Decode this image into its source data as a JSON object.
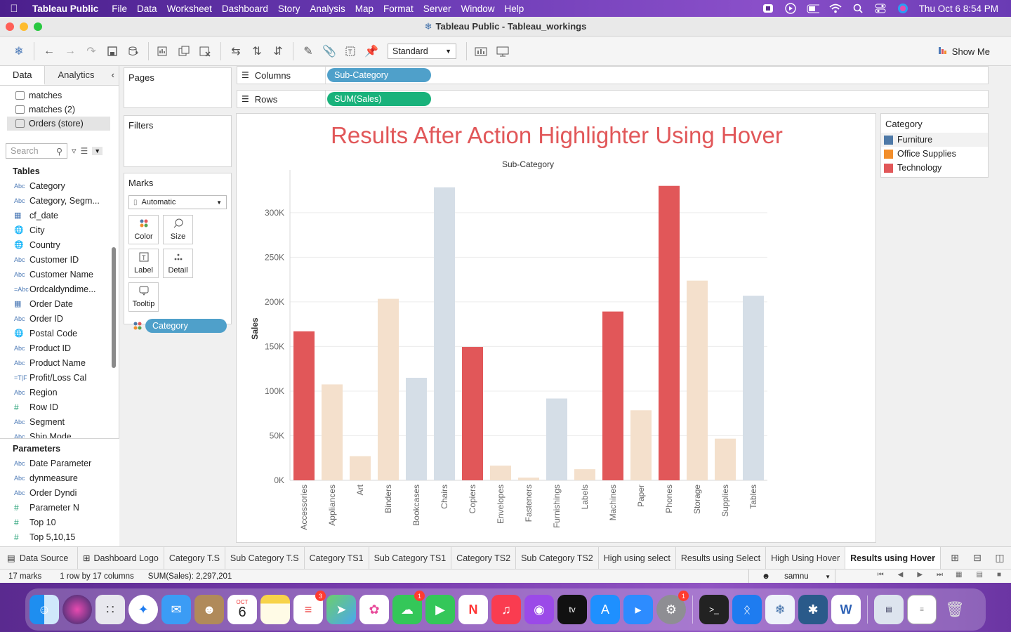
{
  "menubar": {
    "app": "Tableau Public",
    "items": [
      "File",
      "Data",
      "Worksheet",
      "Dashboard",
      "Story",
      "Analysis",
      "Map",
      "Format",
      "Server",
      "Window",
      "Help"
    ],
    "clock": "Thu Oct 6  8:54 PM"
  },
  "window": {
    "title": "Tableau Public - Tableau_workings"
  },
  "toolbar": {
    "fit_select": "Standard",
    "show_me": "Show Me"
  },
  "datapane": {
    "tab_data": "Data",
    "tab_analytics": "Analytics",
    "sources": [
      "matches",
      "matches (2)",
      "Orders (store)"
    ],
    "search_placeholder": "Search",
    "tables_header": "Tables",
    "fields": [
      {
        "type": "Abc",
        "name": "Category"
      },
      {
        "type": "Abc",
        "name": "Category, Segm..."
      },
      {
        "type": "cal",
        "name": "cf_date"
      },
      {
        "type": "geo",
        "name": "City"
      },
      {
        "type": "geo",
        "name": "Country"
      },
      {
        "type": "Abc",
        "name": "Customer ID"
      },
      {
        "type": "Abc",
        "name": "Customer Name"
      },
      {
        "type": "=Abc",
        "name": "Ordcaldyndime..."
      },
      {
        "type": "cal",
        "name": "Order Date"
      },
      {
        "type": "Abc",
        "name": "Order ID"
      },
      {
        "type": "geo",
        "name": "Postal Code"
      },
      {
        "type": "Abc",
        "name": "Product ID"
      },
      {
        "type": "Abc",
        "name": "Product Name"
      },
      {
        "type": "=T|F",
        "name": "Profit/Loss Cal"
      },
      {
        "type": "Abc",
        "name": "Region"
      },
      {
        "type": "#",
        "name": "Row ID"
      },
      {
        "type": "Abc",
        "name": "Segment"
      },
      {
        "type": "Abc",
        "name": "Ship Mode"
      }
    ],
    "parameters_header": "Parameters",
    "parameters": [
      {
        "type": "Abc",
        "name": "Date Parameter"
      },
      {
        "type": "Abc",
        "name": "dynmeasure"
      },
      {
        "type": "Abc",
        "name": "Order Dyndi"
      },
      {
        "type": "#",
        "name": "Parameter N"
      },
      {
        "type": "#",
        "name": "Top 10"
      },
      {
        "type": "#",
        "name": "Top 5,10,15"
      }
    ]
  },
  "cards": {
    "pages": "Pages",
    "filters": "Filters",
    "marks": "Marks",
    "mark_type": "Automatic",
    "mark_buttons": [
      "Color",
      "Size",
      "Label",
      "Detail",
      "Tooltip"
    ],
    "color_pill": "Category"
  },
  "shelves": {
    "columns_label": "Columns",
    "columns_pill": "Sub-Category",
    "rows_label": "Rows",
    "rows_pill": "SUM(Sales)"
  },
  "legend": {
    "title": "Category",
    "items": [
      {
        "name": "Furniture",
        "color": "#4e79a7"
      },
      {
        "name": "Office Supplies",
        "color": "#f28e2b"
      },
      {
        "name": "Technology",
        "color": "#e15759"
      }
    ]
  },
  "chart_data": {
    "type": "bar",
    "title": "Results After Action Highlighter Using Hover",
    "xlabel": "Sub-Category",
    "ylabel": "Sales",
    "ylim": [
      0,
      340000
    ],
    "yticks": [
      0,
      50000,
      100000,
      150000,
      200000,
      250000,
      300000
    ],
    "ytick_labels": [
      "0K",
      "50K",
      "100K",
      "150K",
      "200K",
      "250K",
      "300K"
    ],
    "grid": true,
    "highlighted_category": "Technology",
    "categories": [
      "Accessories",
      "Appliances",
      "Art",
      "Binders",
      "Bookcases",
      "Chairs",
      "Copiers",
      "Envelopes",
      "Fasteners",
      "Furnishings",
      "Labels",
      "Machines",
      "Paper",
      "Phones",
      "Storage",
      "Supplies",
      "Tables"
    ],
    "values": [
      167000,
      107500,
      27100,
      203400,
      114900,
      328400,
      149500,
      16500,
      3000,
      91700,
      12500,
      189200,
      78500,
      330000,
      223800,
      46700,
      206900
    ],
    "category_group": [
      "Technology",
      "Office Supplies",
      "Office Supplies",
      "Office Supplies",
      "Furniture",
      "Furniture",
      "Technology",
      "Office Supplies",
      "Office Supplies",
      "Furniture",
      "Office Supplies",
      "Technology",
      "Office Supplies",
      "Technology",
      "Office Supplies",
      "Office Supplies",
      "Furniture"
    ],
    "colors": {
      "Technology": "#e15759",
      "Office Supplies": "#f4e0cc",
      "Furniture": "#d5dee7"
    }
  },
  "sheet_tabs": {
    "data_source": "Data Source",
    "tabs": [
      "Dashboard Logo",
      "Category T.S",
      "Sub Category T.S",
      "Category TS1",
      "Sub Category TS1",
      "Category TS2",
      "Sub Category TS2",
      "High using select",
      "Results using Select",
      "High Using Hover",
      "Results using Hover"
    ],
    "active": "Results using Hover"
  },
  "status": {
    "marks": "17 marks",
    "dims": "1 row by 17 columns",
    "sum": "SUM(Sales): 2,297,201",
    "user": "samnu"
  },
  "dock": {
    "calendar_month": "OCT",
    "calendar_day": "6",
    "badges": {
      "reminders": "3",
      "messages": "1",
      "settings": "1"
    }
  }
}
